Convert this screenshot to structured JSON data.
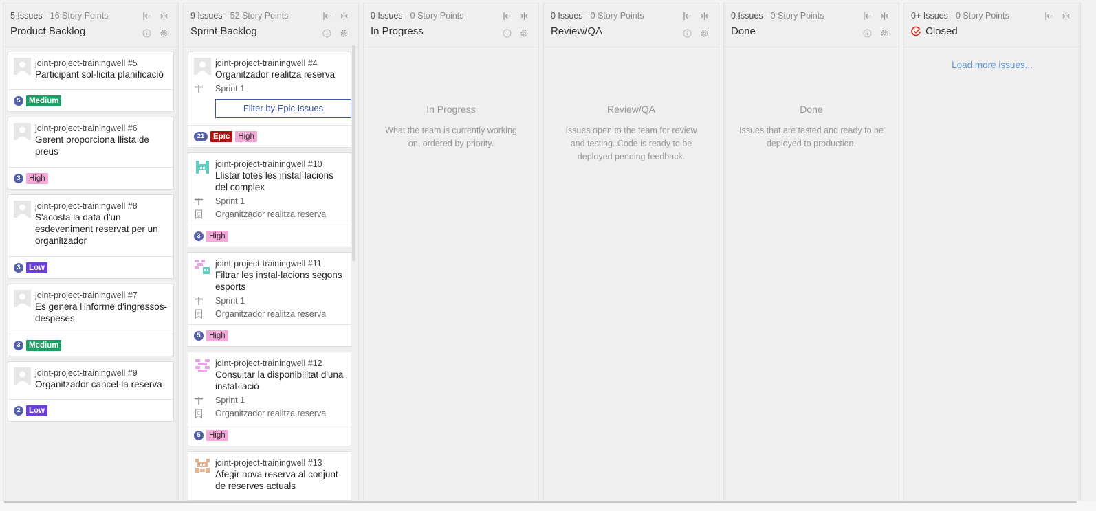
{
  "columns": [
    {
      "meta_count": "5 Issues",
      "meta_points": " - 16 Story Points",
      "title": "Product Backlog",
      "cards": [
        {
          "repo": "joint-project-trainingwell #5",
          "title": "Participant sol·licita planificació",
          "points": "5",
          "labels": [
            "Medium"
          ]
        },
        {
          "repo": "joint-project-trainingwell #6",
          "title": "Gerent proporciona llista de preus",
          "points": "3",
          "labels": [
            "High"
          ]
        },
        {
          "repo": "joint-project-trainingwell #8",
          "title": "S'acosta la data d'un esdeveniment reservat per un organitzador",
          "points": "3",
          "labels": [
            "Low"
          ]
        },
        {
          "repo": "joint-project-trainingwell #7",
          "title": "Es genera l'informe d'ingressos-despeses",
          "points": "3",
          "labels": [
            "Medium"
          ]
        },
        {
          "repo": "joint-project-trainingwell #9",
          "title": "Organitzador cancel·la reserva",
          "points": "2",
          "labels": [
            "Low"
          ]
        }
      ]
    },
    {
      "meta_count": "9 Issues",
      "meta_points": " - 52 Story Points",
      "title": "Sprint Backlog",
      "cards": [
        {
          "repo": "joint-project-trainingwell #4",
          "title": "Organitzador realitza reserva",
          "milestone": "Sprint 1",
          "button": "Filter by Epic Issues",
          "points": "21",
          "labels": [
            "Epic",
            "High"
          ]
        },
        {
          "repo": "joint-project-trainingwell #10",
          "title": "Llistar totes les instal·lacions del complex",
          "milestone": "Sprint 1",
          "epic": "Organitzador realitza reserva",
          "points": "3",
          "labels": [
            "High"
          ]
        },
        {
          "repo": "joint-project-trainingwell #11",
          "title": "Filtrar les instal·lacions segons esports",
          "milestone": "Sprint 1",
          "epic": "Organitzador realitza reserva",
          "points": "5",
          "labels": [
            "High"
          ]
        },
        {
          "repo": "joint-project-trainingwell #12",
          "title": "Consultar la disponibilitat d'una instal·lació",
          "milestone": "Sprint 1",
          "epic": "Organitzador realitza reserva",
          "points": "5",
          "labels": [
            "High"
          ]
        },
        {
          "repo": "joint-project-trainingwell #13",
          "title": "Afegir nova reserva al conjunt de reserves actuals"
        }
      ]
    },
    {
      "meta_count": "0 Issues",
      "meta_points": " - 0 Story Points",
      "title": "In Progress",
      "empty_title": "In Progress",
      "empty_desc": "What the team is currently working on, ordered by priority."
    },
    {
      "meta_count": "0 Issues",
      "meta_points": " - 0 Story Points",
      "title": "Review/QA",
      "empty_title": "Review/QA",
      "empty_desc": "Issues open to the team for review and testing. Code is ready to be deployed pending feedback."
    },
    {
      "meta_count": "0 Issues",
      "meta_points": " - 0 Story Points",
      "title": "Done",
      "empty_title": "Done",
      "empty_desc": "Issues that are tested and ready to be deployed to production."
    },
    {
      "meta_count": "0+ Issues",
      "meta_points": " - 0 Story Points",
      "title": "Closed",
      "load_more": "Load more issues..."
    }
  ],
  "colors": {
    "medium": "#1b9e63",
    "high": "#f3a9d7",
    "low": "#6b3fd8",
    "epic": "#b11212",
    "points": "#5460a8",
    "link": "#5b9bd5",
    "closed_icon": "#d2301e"
  },
  "icons": [
    "collapse-left-icon",
    "collapse-pipeline-icon",
    "info-icon",
    "settings-icon",
    "milestone-icon",
    "epic-icon",
    "closed-icon",
    "avatar-icon"
  ]
}
